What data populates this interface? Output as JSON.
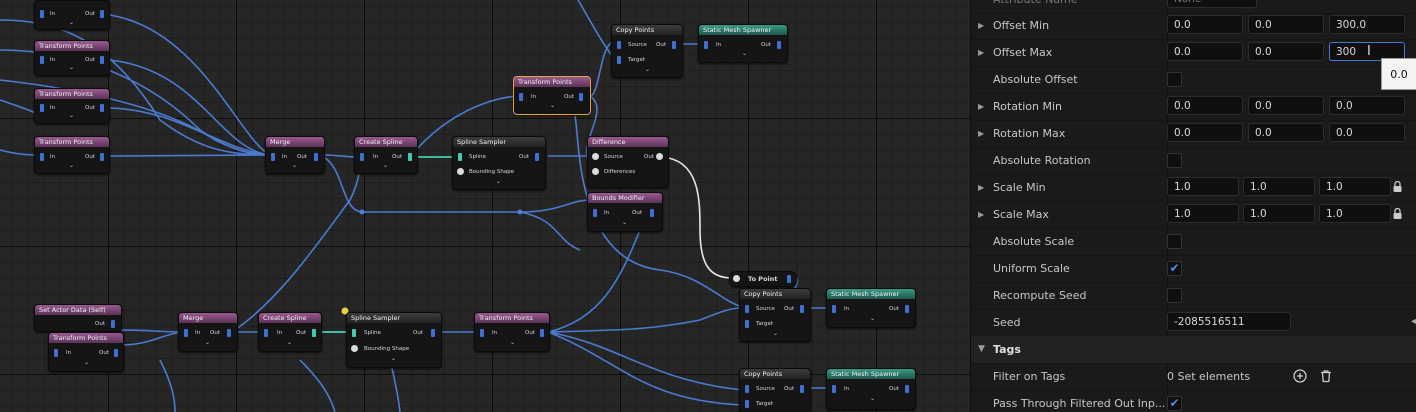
{
  "graph": {
    "nodes": {
      "n_top_left": {
        "title": "",
        "in": "In",
        "out": "Out"
      },
      "n_tp1": {
        "title": "Transform Points",
        "in": "In",
        "out": "Out"
      },
      "n_tp2": {
        "title": "Transform Points",
        "in": "In",
        "out": "Out"
      },
      "n_tp3": {
        "title": "Transform Points",
        "in": "In",
        "out": "Out"
      },
      "n_merge1": {
        "title": "Merge",
        "in": "In",
        "out": "Out"
      },
      "n_cs1": {
        "title": "Create Spline",
        "in": "In",
        "out": "Out"
      },
      "n_ss1": {
        "title": "Spline Sampler",
        "spline": "Spline",
        "out": "Out",
        "bounding": "Bounding Shape"
      },
      "n_tp_sel": {
        "title": "Transform Points",
        "in": "In",
        "out": "Out"
      },
      "n_cp1": {
        "title": "Copy Points",
        "source": "Source",
        "out": "Out",
        "target": "Target"
      },
      "n_sms1": {
        "title": "Static Mesh Spawner",
        "in": "In",
        "out": "Out"
      },
      "n_diff": {
        "title": "Difference",
        "source": "Source",
        "out": "Out",
        "differences": "Differences"
      },
      "n_bm": {
        "title": "Bounds Modifier",
        "in": "In",
        "out": "Out"
      },
      "n_toPoint": {
        "title": "To Point"
      },
      "n_cp2": {
        "title": "Copy Points",
        "source": "Source",
        "out": "Out",
        "target": "Target"
      },
      "n_sms2": {
        "title": "Static Mesh Spawner",
        "in": "In",
        "out": "Out"
      },
      "n_sad": {
        "title": "Set Actor Data (Self)",
        "out": "Out"
      },
      "n_tp4": {
        "title": "Transform Points",
        "in": "In",
        "out": "Out"
      },
      "n_merge2": {
        "title": "Merge",
        "in": "In",
        "out": "Out"
      },
      "n_cs2": {
        "title": "Create Spline",
        "in": "In",
        "out": "Out"
      },
      "n_ss2": {
        "title": "Spline Sampler",
        "spline": "Spline",
        "out": "Out",
        "bounding": "Bounding Shape"
      },
      "n_tp5": {
        "title": "Transform Points",
        "in": "In",
        "out": "Out"
      },
      "n_cp3": {
        "title": "Copy Points",
        "source": "Source",
        "out": "Out",
        "target": "Target"
      },
      "n_sms3": {
        "title": "Static Mesh Spawner",
        "in": "In",
        "out": "Out"
      }
    }
  },
  "details": {
    "top_partial_label": "Attribute Name",
    "top_partial_value": "None",
    "rows": [
      {
        "label": "Offset Min",
        "expandable": true,
        "values": [
          "0.0",
          "0.0",
          "300.0"
        ]
      },
      {
        "label": "Offset Max",
        "expandable": true,
        "values": [
          "0.0",
          "0.0",
          "300"
        ]
      },
      {
        "label": "Absolute Offset",
        "checked": false
      },
      {
        "label": "Rotation Min",
        "expandable": true,
        "values": [
          "0.0",
          "0.0",
          "0.0"
        ]
      },
      {
        "label": "Rotation Max",
        "expandable": true,
        "values": [
          "0.0",
          "0.0",
          "0.0"
        ]
      },
      {
        "label": "Absolute Rotation",
        "checked": false
      },
      {
        "label": "Scale Min",
        "expandable": true,
        "values": [
          "1.0",
          "1.0",
          "1.0"
        ]
      },
      {
        "label": "Scale Max",
        "expandable": true,
        "values": [
          "1.0",
          "1.0",
          "1.0"
        ]
      },
      {
        "label": "Absolute Scale",
        "checked": false
      },
      {
        "label": "Uniform Scale",
        "checked": true
      },
      {
        "label": "Recompute Seed",
        "checked": false
      },
      {
        "label": "Seed",
        "value": "-2085516511"
      }
    ],
    "tags_section": "Tags",
    "filter_on_tags": {
      "label": "Filter on Tags",
      "value": "0 Set elements"
    },
    "pass_through": {
      "label": "Pass Through Filtered Out Inp...",
      "checked": true
    },
    "tooltip": "0.0"
  },
  "colors": {
    "wire_blue": "#4f7fd9",
    "wire_teal": "#3fcfb0",
    "accent_selected": "#e8a33a"
  }
}
